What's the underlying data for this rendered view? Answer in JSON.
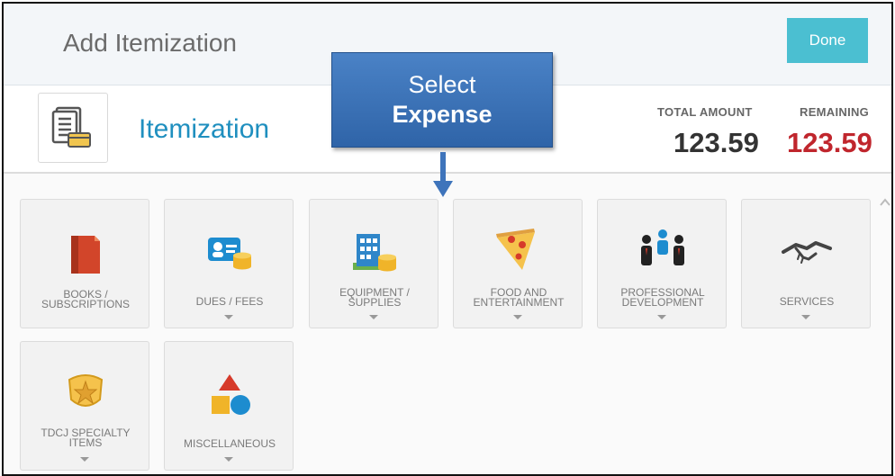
{
  "header": {
    "title": "Add Itemization",
    "done_label": "Done"
  },
  "itemization": {
    "title": "Itemization",
    "total_label": "TOTAL AMOUNT",
    "total_value": "123.59",
    "remaining_label": "REMAINING",
    "remaining_value": "123.59",
    "remaining_color": "#c0262d"
  },
  "callout": {
    "line1": "Select",
    "line2": "Expense"
  },
  "expense_types": [
    {
      "label": "BOOKS / SUBSCRIPTIONS",
      "icon": "book-icon",
      "has_dropdown": false
    },
    {
      "label": "DUES / FEES",
      "icon": "id-card-coins-icon",
      "has_dropdown": true
    },
    {
      "label": "EQUIPMENT / SUPPLIES",
      "icon": "building-coins-icon",
      "has_dropdown": true
    },
    {
      "label": "FOOD AND ENTERTAINMENT",
      "icon": "pizza-icon",
      "has_dropdown": true
    },
    {
      "label": "PROFESSIONAL DEVELOPMENT",
      "icon": "people-icon",
      "has_dropdown": true
    },
    {
      "label": "SERVICES",
      "icon": "handshake-icon",
      "has_dropdown": true
    },
    {
      "label": "TDCJ SPECIALTY ITEMS",
      "icon": "badge-icon",
      "has_dropdown": true
    },
    {
      "label": "MISCELLANEOUS",
      "icon": "shapes-icon",
      "has_dropdown": true
    }
  ]
}
